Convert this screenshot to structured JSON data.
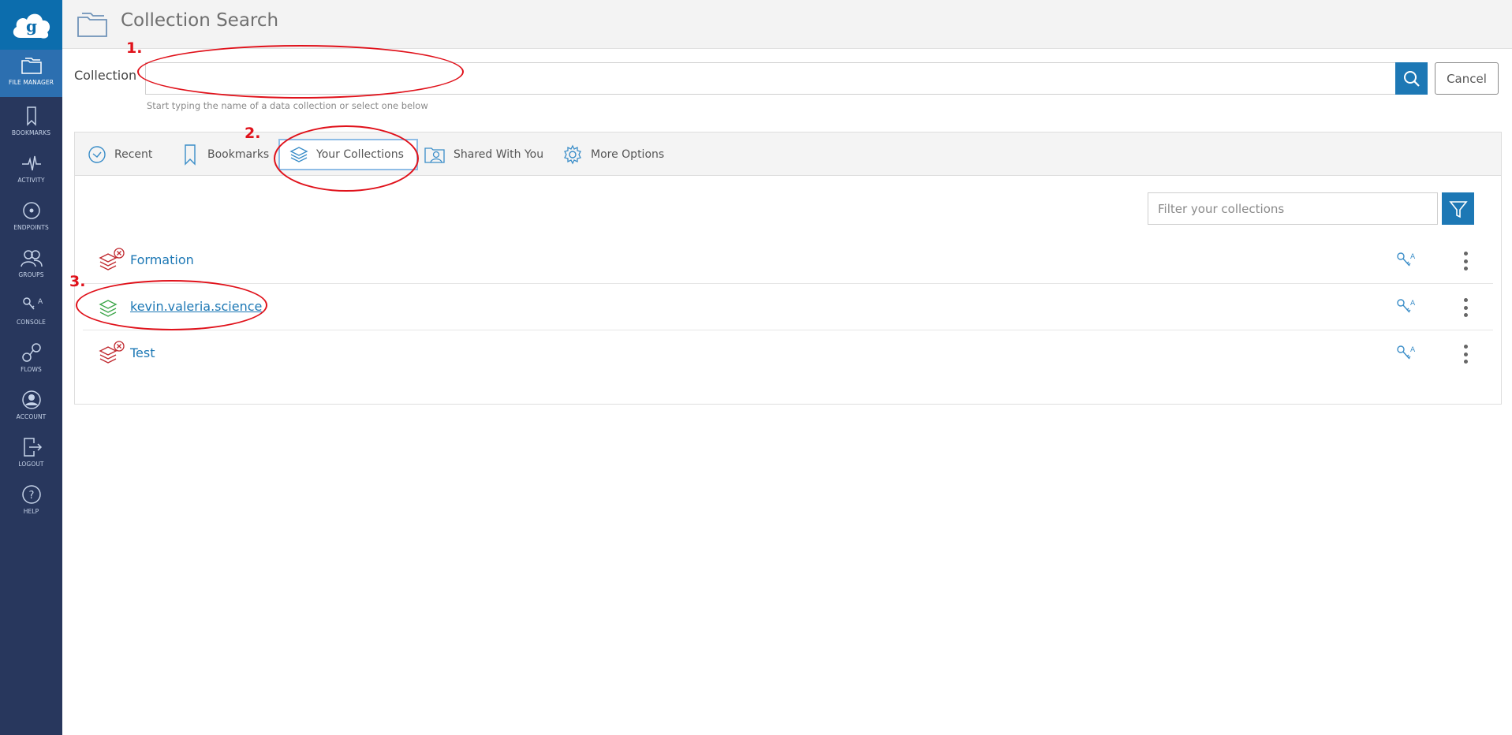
{
  "header": {
    "title": "Collection Search"
  },
  "sidebar": {
    "items": [
      {
        "label": "FILE MANAGER",
        "icon": "folder-icon"
      },
      {
        "label": "BOOKMARKS",
        "icon": "bookmark-icon"
      },
      {
        "label": "ACTIVITY",
        "icon": "activity-icon"
      },
      {
        "label": "ENDPOINTS",
        "icon": "endpoints-icon"
      },
      {
        "label": "GROUPS",
        "icon": "groups-icon"
      },
      {
        "label": "CONSOLE",
        "icon": "console-icon"
      },
      {
        "label": "FLOWS",
        "icon": "flows-icon"
      },
      {
        "label": "ACCOUNT",
        "icon": "account-icon"
      },
      {
        "label": "LOGOUT",
        "icon": "logout-icon"
      },
      {
        "label": "HELP",
        "icon": "help-icon"
      }
    ]
  },
  "search": {
    "label": "Collection",
    "value": "",
    "hint": "Start typing the name of a data collection or select one below",
    "cancel_label": "Cancel"
  },
  "tabs": [
    {
      "label": "Recent"
    },
    {
      "label": "Bookmarks"
    },
    {
      "label": "Your Collections"
    },
    {
      "label": "Shared With You"
    },
    {
      "label": "More Options"
    }
  ],
  "filter": {
    "placeholder": "Filter your collections"
  },
  "collections": [
    {
      "name": "Formation",
      "status": "error"
    },
    {
      "name": "kevin.valeria.science",
      "status": "ok"
    },
    {
      "name": "Test",
      "status": "error"
    }
  ],
  "annotations": [
    "1.",
    "2.",
    "3."
  ],
  "colors": {
    "sidebar": "#28375d",
    "accent": "#1d78b5",
    "annotation": "#e0121b"
  }
}
